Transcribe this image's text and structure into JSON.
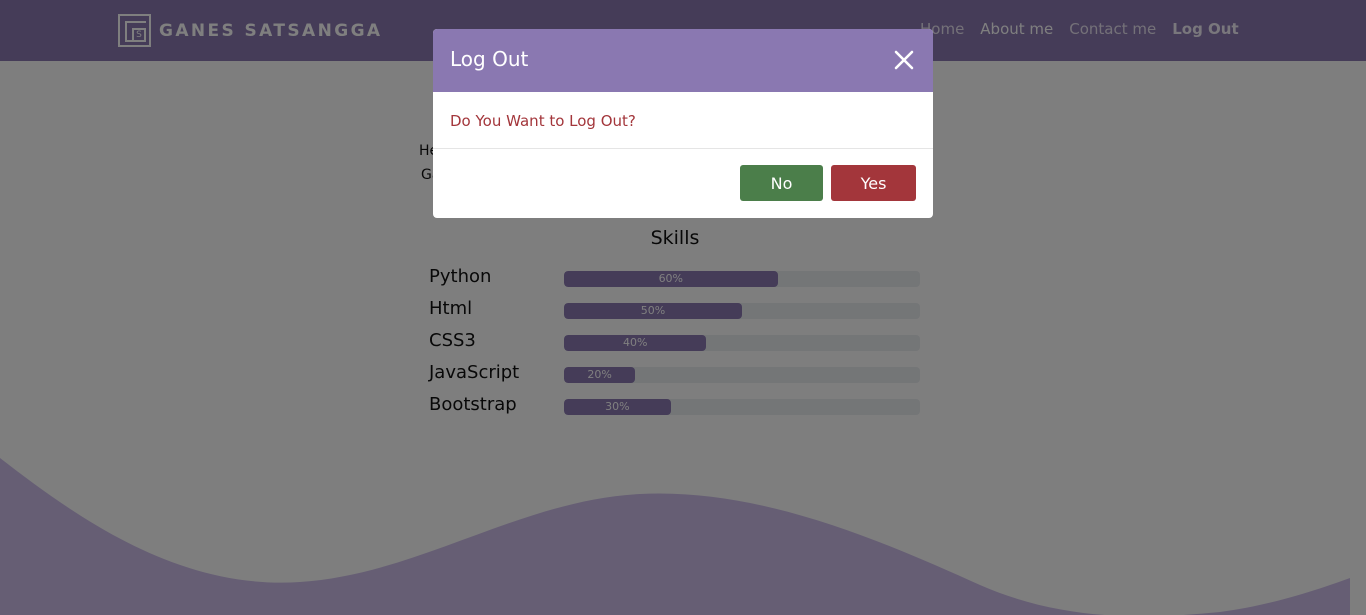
{
  "navbar": {
    "brand_name": "GANES SATSANGGA",
    "logo_letter": "S",
    "links": [
      {
        "label": "Home"
      },
      {
        "label": "About me"
      },
      {
        "label": "Contact me"
      },
      {
        "label": "Log Out"
      }
    ]
  },
  "main": {
    "hello_line1": "He",
    "hello_line2": "Ga",
    "skills_title": "Skills",
    "skills": [
      {
        "name": "Python",
        "percent": 60,
        "label": "60%"
      },
      {
        "name": "Html",
        "percent": 50,
        "label": "50%"
      },
      {
        "name": "CSS3",
        "percent": 40,
        "label": "40%"
      },
      {
        "name": "JavaScript",
        "percent": 20,
        "label": "20%"
      },
      {
        "name": "Bootstrap",
        "percent": 30,
        "label": "30%"
      }
    ]
  },
  "modal": {
    "title": "Log Out",
    "question": "Do You Want to Log Out?",
    "no_label": "No",
    "yes_label": "Yes"
  },
  "colors": {
    "accent": "#8a78b1",
    "no_button": "#4b7e4a",
    "yes_button": "#a3363b"
  },
  "icons": {
    "close": "close-icon",
    "logo": "logo-icon"
  }
}
